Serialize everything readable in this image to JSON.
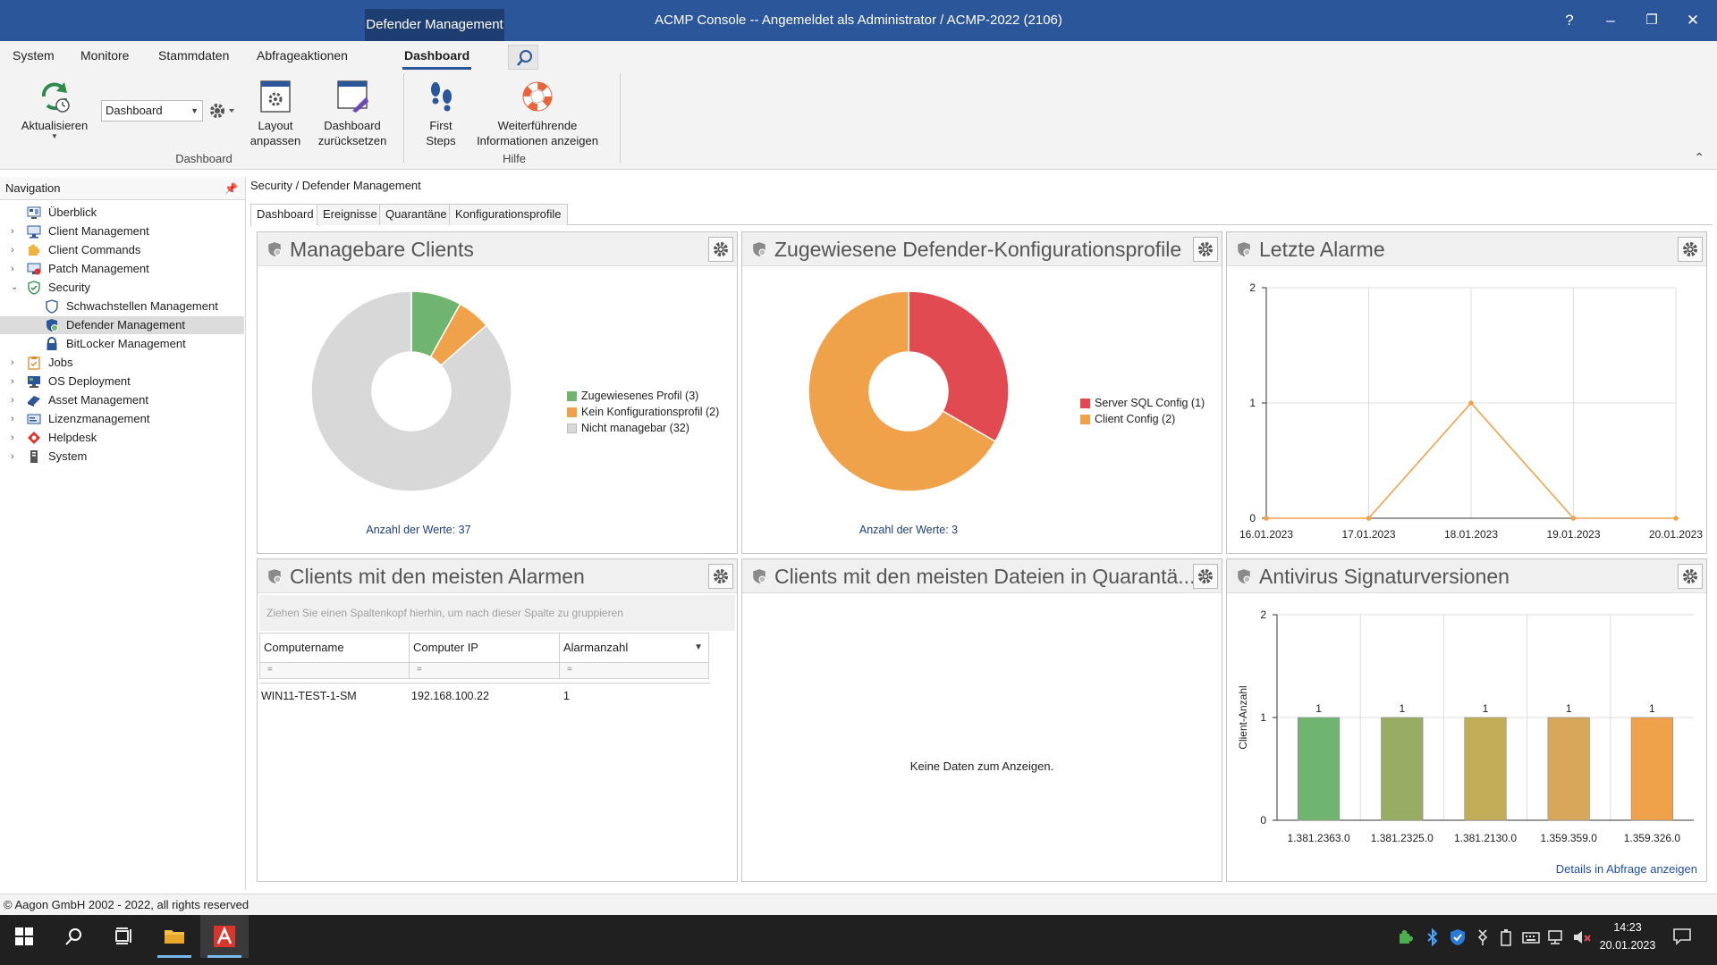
{
  "window": {
    "context_tab": "Defender Management",
    "title": "ACMP Console -- Angemeldet als Administrator / ACMP-2022 (2106)",
    "help": "?",
    "minimize": "–",
    "restore": "❐",
    "close": "✕"
  },
  "ribbon_tabs": [
    "System",
    "Monitore",
    "Stammdaten",
    "Abfrageaktionen",
    "Dashboard"
  ],
  "ribbon": {
    "refresh_label": "Aktualisieren",
    "dashboard_select": "Dashboard",
    "layout_label_1": "Layout",
    "layout_label_2": "anpassen",
    "reset_label_1": "Dashboard",
    "reset_label_2": "zurücksetzen",
    "group_dashboard": "Dashboard",
    "first_steps_1": "First",
    "first_steps_2": "Steps",
    "more_info_1": "Weiterführende",
    "more_info_2": "Informationen anzeigen",
    "group_help": "Hilfe"
  },
  "nav": {
    "header": "Navigation",
    "items": [
      {
        "label": "Überblick"
      },
      {
        "label": "Client Management"
      },
      {
        "label": "Client Commands"
      },
      {
        "label": "Patch Management"
      },
      {
        "label": "Security"
      },
      {
        "label": "Schwachstellen Management"
      },
      {
        "label": "Defender Management"
      },
      {
        "label": "BitLocker Management"
      },
      {
        "label": "Jobs"
      },
      {
        "label": "OS Deployment"
      },
      {
        "label": "Asset Management"
      },
      {
        "label": "Lizenzmanagement"
      },
      {
        "label": "Helpdesk"
      },
      {
        "label": "System"
      }
    ]
  },
  "breadcrumb": "Security / Defender Management",
  "main_tabs": [
    "Dashboard",
    "Ereignisse",
    "Quarantäne",
    "Konfigurationsprofile"
  ],
  "panels": {
    "manageable": {
      "title": "Managebare Clients",
      "count_label": "Anzahl der Werte: 37",
      "legend": [
        {
          "label": "Zugewiesenes Profil (3)",
          "color": "#6fb56f"
        },
        {
          "label": "Kein Konfigurationsprofil (2)",
          "color": "#f0a24a"
        },
        {
          "label": "Nicht managebar (32)",
          "color": "#d8d8d8"
        }
      ]
    },
    "profiles": {
      "title": "Zugewiesene Defender-Konfigurationsprofile",
      "count_label": "Anzahl der Werte: 3",
      "legend": [
        {
          "label": "Server SQL Config (1)",
          "color": "#e04a50"
        },
        {
          "label": "Client Config (2)",
          "color": "#f0a24a"
        }
      ]
    },
    "alarms": {
      "title": "Letzte Alarme"
    },
    "top_alarms": {
      "title": "Clients mit den meisten Alarmen",
      "group_hint": "Ziehen Sie einen Spaltenkopf hierhin, um nach dieser Spalte zu gruppieren",
      "columns": [
        "Computername",
        "Computer IP",
        "Alarmanzahl"
      ],
      "filter_symbol": "=",
      "rows": [
        [
          "WIN11-TEST-1-SM",
          "192.168.100.22",
          "1"
        ]
      ]
    },
    "quarantine": {
      "title": "Clients mit den meisten Dateien in Quarantä...",
      "no_data": "Keine Daten zum Anzeigen."
    },
    "signatures": {
      "title": "Antivirus Signaturversionen",
      "details_link": "Details in Abfrage anzeigen"
    }
  },
  "chart_data": [
    {
      "type": "pie",
      "categories": [
        "Zugewiesenes Profil",
        "Kein Konfigurationsprofil",
        "Nicht managebar"
      ],
      "values": [
        3,
        2,
        32
      ],
      "colors": [
        "#6fb56f",
        "#f0a24a",
        "#d8d8d8"
      ]
    },
    {
      "type": "pie",
      "categories": [
        "Server SQL Config",
        "Client Config"
      ],
      "values": [
        1,
        2
      ],
      "colors": [
        "#e04a50",
        "#f0a24a"
      ]
    },
    {
      "type": "line",
      "x": [
        "16.01.2023",
        "17.01.2023",
        "18.01.2023",
        "19.01.2023",
        "20.01.2023"
      ],
      "values": [
        0,
        0,
        1,
        0,
        0
      ],
      "ylim": [
        0,
        2
      ],
      "yticks": [
        "0",
        "1",
        "2"
      ],
      "color": "#f0a24a",
      "grid": true
    },
    {
      "type": "bar",
      "categories": [
        "1.381.2363.0",
        "1.381.2325.0",
        "1.381.2130.0",
        "1.359.359.0",
        "1.359.326.0"
      ],
      "values": [
        1,
        1,
        1,
        1,
        1
      ],
      "ylabel": "Client-Anzahl",
      "ylim": [
        0,
        2
      ],
      "yticks": [
        "0",
        "1",
        "2"
      ],
      "colors": [
        "#6fb56f",
        "#98ad63",
        "#c2ad58",
        "#d9a75a",
        "#f0a24a"
      ],
      "grid": true
    }
  ],
  "statusbar": "© Aagon GmbH 2002 - 2022, all rights reserved",
  "taskbar": {
    "time": "14:23",
    "date": "20.01.2023"
  }
}
